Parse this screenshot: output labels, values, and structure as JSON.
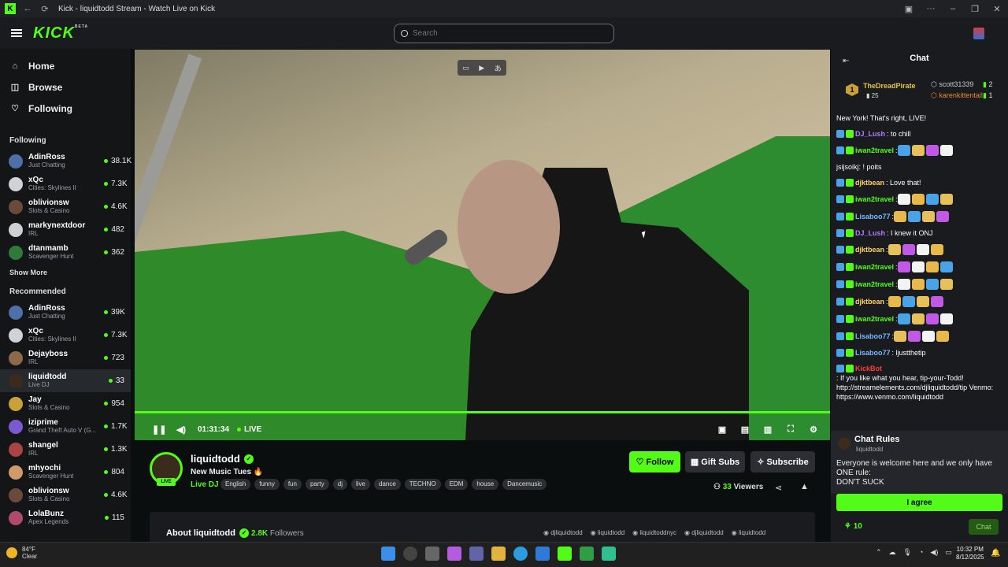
{
  "window": {
    "title": "Kick - liquidtodd Stream - Watch Live on Kick"
  },
  "header": {
    "logo": "KICK",
    "beta": "BETA",
    "search_placeholder": "Search"
  },
  "nav": {
    "home": "Home",
    "browse": "Browse",
    "following": "Following"
  },
  "sidebar": {
    "following_title": "Following",
    "following": [
      {
        "name": "AdinRoss",
        "category": "Just Chatting",
        "viewers": "38.1K",
        "color": "#4f6fa8"
      },
      {
        "name": "xQc",
        "category": "Cities: Skylines II",
        "viewers": "7.3K",
        "color": "#cfd3d6"
      },
      {
        "name": "oblivionsw",
        "category": "Slots & Casino",
        "viewers": "4.6K",
        "color": "#6a4a3a"
      },
      {
        "name": "markynextdoor",
        "category": "IRL",
        "viewers": "482",
        "color": "#d0d0d0"
      },
      {
        "name": "dtanmamb",
        "category": "Scavenger Hunt",
        "viewers": "362",
        "color": "#2f7a3a"
      }
    ],
    "show_more": "Show More",
    "recommended_title": "Recommended",
    "recommended": [
      {
        "name": "AdinRoss",
        "category": "Just Chatting",
        "viewers": "39K",
        "color": "#4f6fa8"
      },
      {
        "name": "xQc",
        "category": "Cities: Skylines II",
        "viewers": "7.3K",
        "color": "#cfd3d6"
      },
      {
        "name": "Dejayboss",
        "category": "IRL",
        "viewers": "723",
        "color": "#8a6a4a"
      },
      {
        "name": "liquidtodd",
        "category": "Live DJ",
        "viewers": "33",
        "color": "#3a2b1c"
      },
      {
        "name": "Jay",
        "category": "Slots & Casino",
        "viewers": "954",
        "color": "#c9a03a"
      },
      {
        "name": "iziprime",
        "category": "Grand Theft Auto V (G...",
        "viewers": "1.7K",
        "color": "#7a5ad0"
      },
      {
        "name": "shangel",
        "category": "IRL",
        "viewers": "1.3K",
        "color": "#a44"
      },
      {
        "name": "mhyochi",
        "category": "Scavenger Hunt",
        "viewers": "804",
        "color": "#d29a6a"
      },
      {
        "name": "oblivionsw",
        "category": "Slots & Casino",
        "viewers": "4.6K",
        "color": "#6a4a3a"
      },
      {
        "name": "LolaBunz",
        "category": "Apex Legends",
        "viewers": "115",
        "color": "#b04a6a"
      }
    ]
  },
  "player": {
    "time": "01:31:34",
    "live": "LIVE",
    "progress": 1.0
  },
  "channel": {
    "name": "liquidtodd",
    "live_badge": "LIVE",
    "stream_title": "New Music Tues 🔥",
    "category": "Live DJ",
    "tags": [
      "English",
      "funny",
      "fun",
      "party",
      "dj",
      "live",
      "dance",
      "TECHNO",
      "EDM",
      "house",
      "Dancemusic"
    ],
    "follow": "Follow",
    "gift_subs": "Gift Subs",
    "subscribe": "Subscribe",
    "viewers_count": "33",
    "viewers_label": "Viewers",
    "about": "About liquidtodd",
    "followers_count": "2.8K",
    "followers_label": "Followers",
    "socials": [
      "djliquidtodd",
      "liquidtodd",
      "liquidtoddnyc",
      "djliquidtodd",
      "liquidtodd"
    ]
  },
  "chat": {
    "title": "Chat",
    "leaders": [
      {
        "rank": "1",
        "name": "TheDreadPirate",
        "count": "25"
      },
      {
        "name": "scott31339",
        "count": "2"
      },
      {
        "name": "karenkittentail",
        "count": "1"
      }
    ],
    "messages": [
      {
        "user": "",
        "text": "New York! That's right, LIVE!",
        "color": "#fff"
      },
      {
        "user": "DJ_Lush",
        "text": ": to chill",
        "color": "#b57cff"
      },
      {
        "user": "iwan2travel",
        "text": ":",
        "color": "#53fc18"
      },
      {
        "user": "",
        "text": "jsijsoikj: ! poits",
        "color": "#fff"
      },
      {
        "user": "djktbean",
        "text": ": Love that!",
        "color": "#ffd166"
      },
      {
        "user": "iwan2travel",
        "text": ":",
        "color": "#53fc18"
      },
      {
        "user": "Lisaboo77",
        "text": ":",
        "color": "#7ab8ff"
      },
      {
        "user": "DJ_Lush",
        "text": ": I knew it ONJ",
        "color": "#b57cff"
      },
      {
        "user": "djktbean",
        "text": ":",
        "color": "#ffd166"
      },
      {
        "user": "iwan2travel",
        "text": ":",
        "color": "#53fc18"
      },
      {
        "user": "iwan2travel",
        "text": ":",
        "color": "#53fc18"
      },
      {
        "user": "djktbean",
        "text": ":",
        "color": "#ffd166"
      },
      {
        "user": "iwan2travel",
        "text": ":",
        "color": "#53fc18"
      },
      {
        "user": "Lisaboo77",
        "text": ":",
        "color": "#7ab8ff"
      },
      {
        "user": "Lisaboo77",
        "text": ": ljustthetip",
        "color": "#7ab8ff"
      },
      {
        "user": "KickBot",
        "text": ": If you like what you hear, tip-your-Todd! http://streamelements.com/djliquidtodd/tip Venmo: https://www.venmo.com/liquidtodd",
        "color": "#ff3b3b"
      }
    ],
    "rules_title": "Chat Rules",
    "rules_user": "liquidtodd",
    "rules_text": "Everyone is welcome here and we only have ONE rule:",
    "rules_rule": "DON'T SUCK",
    "agree": "I agree",
    "points": "10",
    "chat_button": "Chat"
  },
  "taskbar": {
    "temp": "84°F",
    "weather": "Clear",
    "time": "10:32 PM",
    "date": "8/12/2025"
  }
}
